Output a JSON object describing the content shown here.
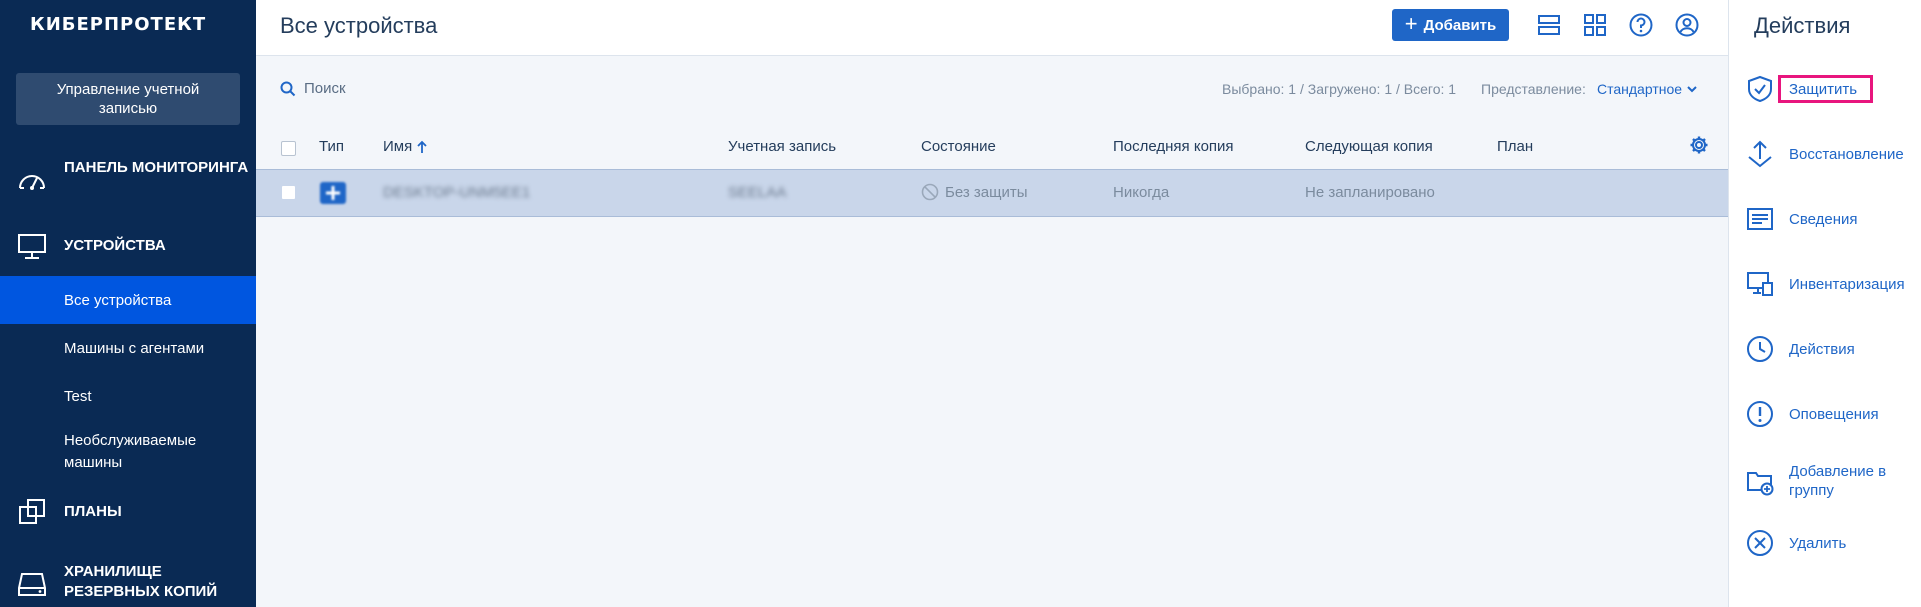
{
  "app": {
    "logo": "КИБЕРПРОТЕКТ"
  },
  "sidebar": {
    "account_button": "Управление учетной записью",
    "sections": [
      {
        "label": "ПАНЕЛЬ МОНИТОРИНГА",
        "icon": "gauge-icon"
      },
      {
        "label": "УСТРОЙСТВА",
        "icon": "monitor-icon"
      },
      {
        "label": "ПЛАНЫ",
        "icon": "plans-icon"
      },
      {
        "label": "ХРАНИЛИЩЕ РЕЗЕРВНЫХ КОПИЙ",
        "icon": "storage-icon"
      }
    ],
    "device_items": [
      {
        "label": "Все устройства",
        "active": true
      },
      {
        "label": "Машины с агентами"
      },
      {
        "label": "Test"
      },
      {
        "label": "Необслуживаемые машины"
      }
    ]
  },
  "header": {
    "title": "Все устройства",
    "add_button": "Добавить"
  },
  "toolbar": {
    "search_placeholder": "Поиск",
    "counts": "Выбрано: 1 / Загружено: 1 / Всего: 1",
    "view_label": "Представление:",
    "view_value": "Стандартное"
  },
  "table": {
    "columns": {
      "type": "Тип",
      "name": "Имя",
      "account": "Учетная запись",
      "state": "Состояние",
      "last_backup": "Последняя копия",
      "next_backup": "Следующая копия",
      "plan": "План"
    },
    "rows": [
      {
        "name": "DESKTOP-UNM5EE1",
        "account": "SEELAA",
        "state": "Без защиты",
        "last_backup": "Никогда",
        "next_backup": "Не запланировано",
        "plan": ""
      }
    ]
  },
  "actions": {
    "title": "Действия",
    "items": [
      {
        "label": "Защитить",
        "icon": "shield-check-icon"
      },
      {
        "label": "Восстановление",
        "icon": "recover-icon"
      },
      {
        "label": "Сведения",
        "icon": "details-icon"
      },
      {
        "label": "Инвентаризация",
        "icon": "inventory-icon"
      },
      {
        "label": "Действия",
        "icon": "clock-icon"
      },
      {
        "label": "Оповещения",
        "icon": "alert-icon"
      },
      {
        "label": "Добавление в группу",
        "icon": "folder-add-icon"
      },
      {
        "label": "Удалить",
        "icon": "delete-icon"
      }
    ]
  },
  "colors": {
    "sidebar_bg": "#0a2a54",
    "accent": "#1f66c7",
    "active_nav": "#0056e0",
    "highlight": "#e8157e"
  }
}
